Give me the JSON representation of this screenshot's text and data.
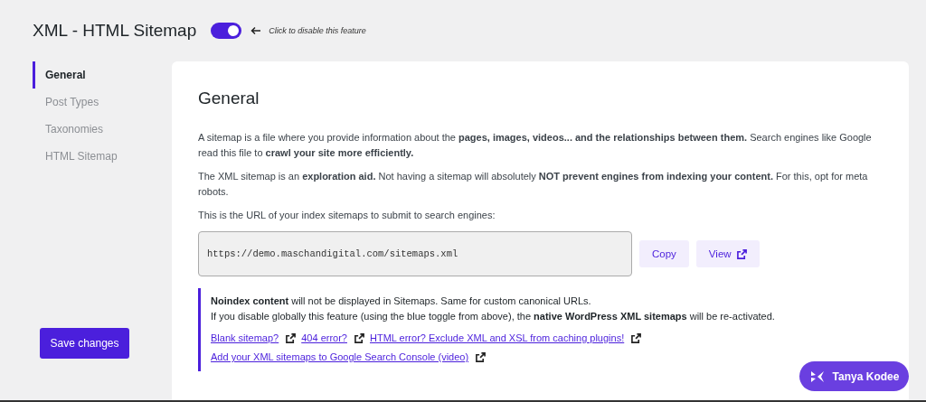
{
  "header": {
    "title": "XML - HTML Sitemap",
    "toggle": {
      "on": true
    },
    "hint": "Click to disable this feature"
  },
  "sidebar": {
    "items": [
      {
        "label": "General",
        "selected": true
      },
      {
        "label": "Post Types",
        "selected": false
      },
      {
        "label": "Taxonomies",
        "selected": false
      },
      {
        "label": "HTML Sitemap",
        "selected": false
      }
    ]
  },
  "save_button": "Save changes",
  "content": {
    "heading": "General",
    "paragraphs": [
      "A sitemap is a file where you provide information about the **pages, images, videos... and the relationships between them.** Search engines like Google read this file to **crawl your site more efficiently.**",
      "The XML sitemap is an **exploration aid.** Not having a sitemap will absolutely **NOT prevent engines from indexing your content.** For this, opt for meta robots.",
      "This is the URL of your index sitemaps to submit to search engines:"
    ],
    "url_field": {
      "value": "https://demo.maschandigital.com/sitemaps.xml"
    },
    "buttons": [
      {
        "label": "Copy",
        "kind": "copy"
      },
      {
        "label": "View",
        "kind": "view"
      }
    ],
    "notice": {
      "lines": [
        "**Noindex content** will not be displayed in Sitemaps. Same for custom canonical URLs.",
        "If you disable globally this feature (using the blue toggle from above), the **native WordPress XML sitemaps** will be re-activated."
      ],
      "links": [
        "Blank sitemap?",
        "404 error?",
        "HTML error? Exclude XML and XSL from caching plugins!",
        "Add your XML sitemaps to Google Search Console (video)"
      ]
    }
  },
  "chat_badge": {
    "label": "Tanya Kodee"
  }
}
